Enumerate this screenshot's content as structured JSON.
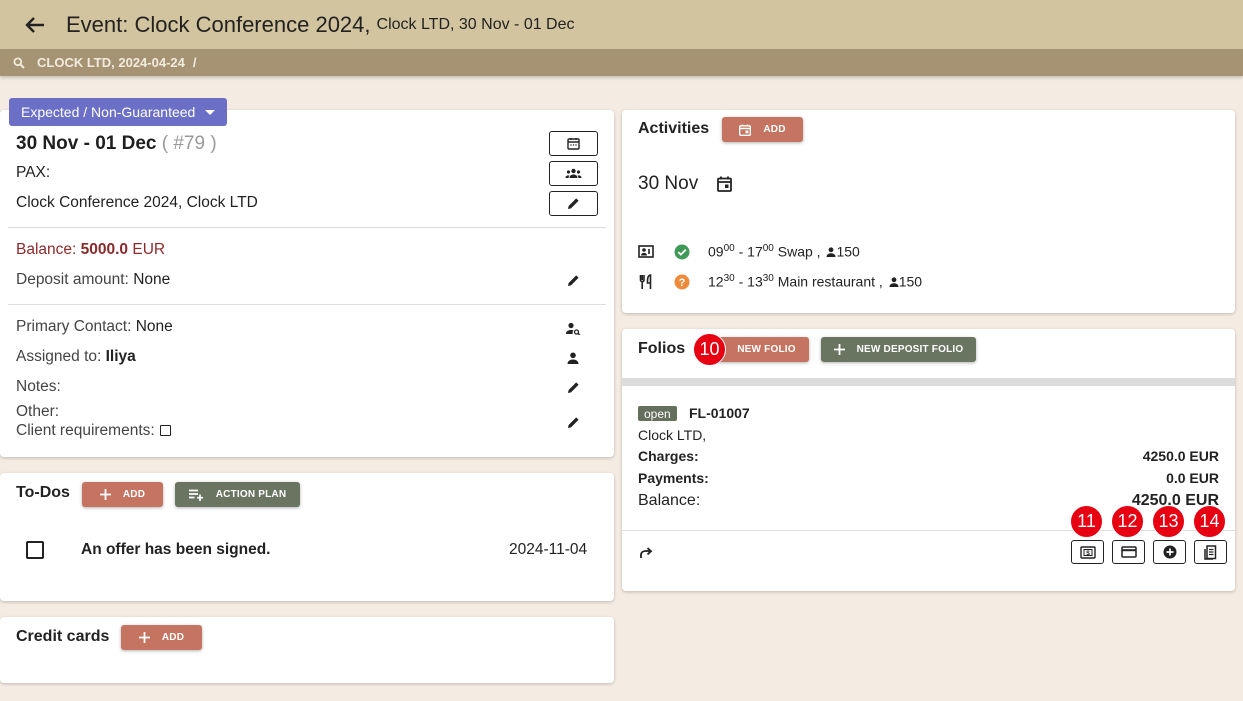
{
  "header": {
    "title": "Event: Clock Conference 2024,",
    "subtitle": "Clock LTD, 30 Nov - 01 Dec"
  },
  "breadcrumb": {
    "item": "CLOCK LTD, 2024-04-24",
    "separator": "/"
  },
  "colors": {
    "header_bg": "#d3c4a0",
    "breadcrumb_bg": "#a69373",
    "page_bg": "#f4ece3",
    "status_chip": "#6b6fc6",
    "accent_red": "#c47460",
    "accent_green": "#6a7561",
    "balance_red": "#8b2a2a",
    "marker_red": "#e60012"
  },
  "event": {
    "status": "Expected / Non-Guaranteed",
    "dates": "30 Nov - 01 Dec",
    "number": "( #79 )",
    "pax_label": "PAX:",
    "name": "Clock Conference 2024, Clock LTD",
    "balance_label": "Balance:",
    "balance_value": "5000.0",
    "balance_currency": "EUR",
    "deposit_label": "Deposit amount:",
    "deposit_value": "None",
    "primary_contact_label": "Primary Contact:",
    "primary_contact_value": "None",
    "assigned_label": "Assigned to:",
    "assigned_value": "Iliya",
    "notes_label": "Notes:",
    "other_label": "Other:",
    "client_req_label": "Client requirements:"
  },
  "todos": {
    "title": "To-Dos",
    "add_label": "ADD",
    "action_plan_label": "ACTION PLAN",
    "items": [
      {
        "text": "An offer has been signed.",
        "date": "2024-11-04"
      }
    ]
  },
  "credit_cards": {
    "title": "Credit cards",
    "add_label": "ADD"
  },
  "activities": {
    "title": "Activities",
    "add_label": "ADD",
    "date": "30 Nov",
    "items": [
      {
        "icon": "meeting-room-icon",
        "status_icon": "check-circle-icon",
        "start_h": "09",
        "start_m": "00",
        "end_h": "17",
        "end_m": "00",
        "place": "Swap ,",
        "pax": "150"
      },
      {
        "icon": "restaurant-icon",
        "status_icon": "question-circle-icon",
        "start_h": "12",
        "start_m": "30",
        "end_h": "13",
        "end_m": "30",
        "place": "Main restaurant ,",
        "pax": "150"
      }
    ]
  },
  "folios": {
    "title": "Folios",
    "new_folio_label": "NEW FOLIO",
    "new_deposit_label": "NEW DEPOSIT FOLIO",
    "folio": {
      "status": "open",
      "id": "FL-01007",
      "client": "Clock LTD,",
      "charges_label": "Charges:",
      "charges_value": "4250.0 EUR",
      "payments_label": "Payments:",
      "payments_value": "0.0 EUR",
      "balance_label": "Balance:",
      "balance_value": "4250.0 EUR"
    }
  },
  "markers": [
    "10",
    "11",
    "12",
    "13",
    "14"
  ]
}
